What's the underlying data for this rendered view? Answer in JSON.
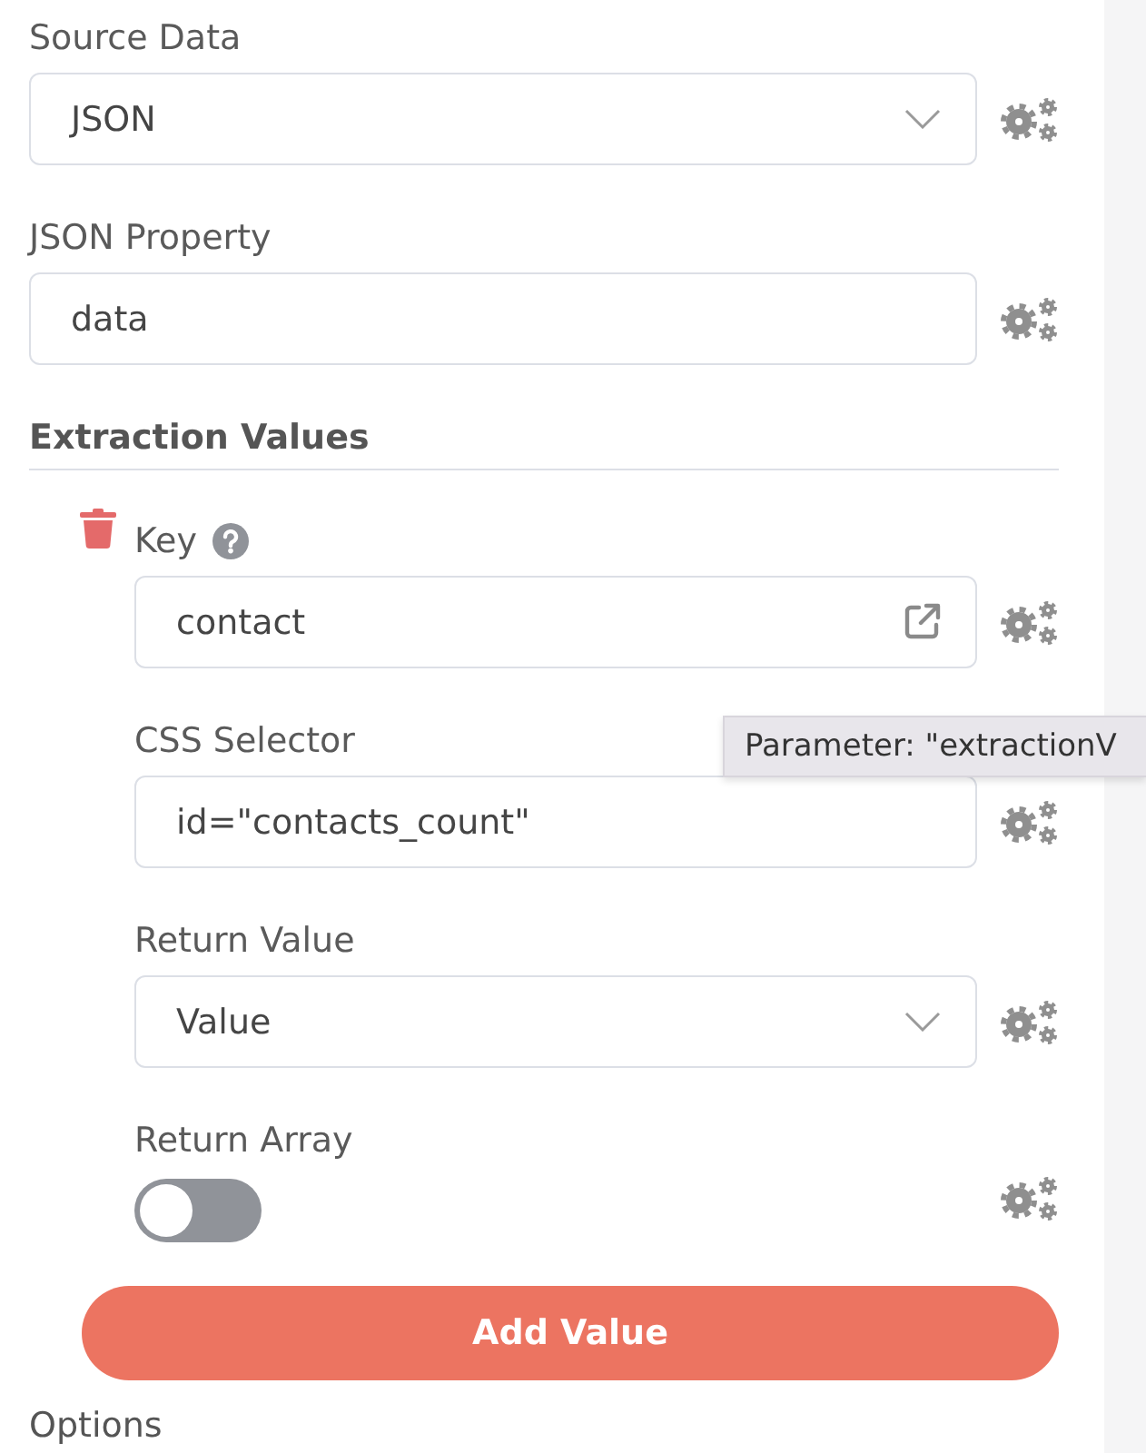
{
  "fields": [
    {
      "kind": "select",
      "label": "Source Data",
      "value": "JSON"
    },
    {
      "kind": "text",
      "label": "JSON Property",
      "value": "data"
    }
  ],
  "extraction_values": {
    "title": "Extraction Values",
    "items": [
      {
        "fields": [
          {
            "kind": "text",
            "label": "Key",
            "value": "contact",
            "help": true,
            "link": true
          },
          {
            "kind": "text",
            "label": "CSS Selector",
            "value": "id=\"contacts_count\""
          },
          {
            "kind": "select",
            "label": "Return Value",
            "value": "Value"
          },
          {
            "kind": "toggle",
            "label": "Return Array",
            "on": false
          }
        ]
      }
    ],
    "add_button": "Add Value"
  },
  "tooltip": {
    "text": "Parameter: \"extractionV"
  },
  "options": {
    "title": "Options"
  }
}
